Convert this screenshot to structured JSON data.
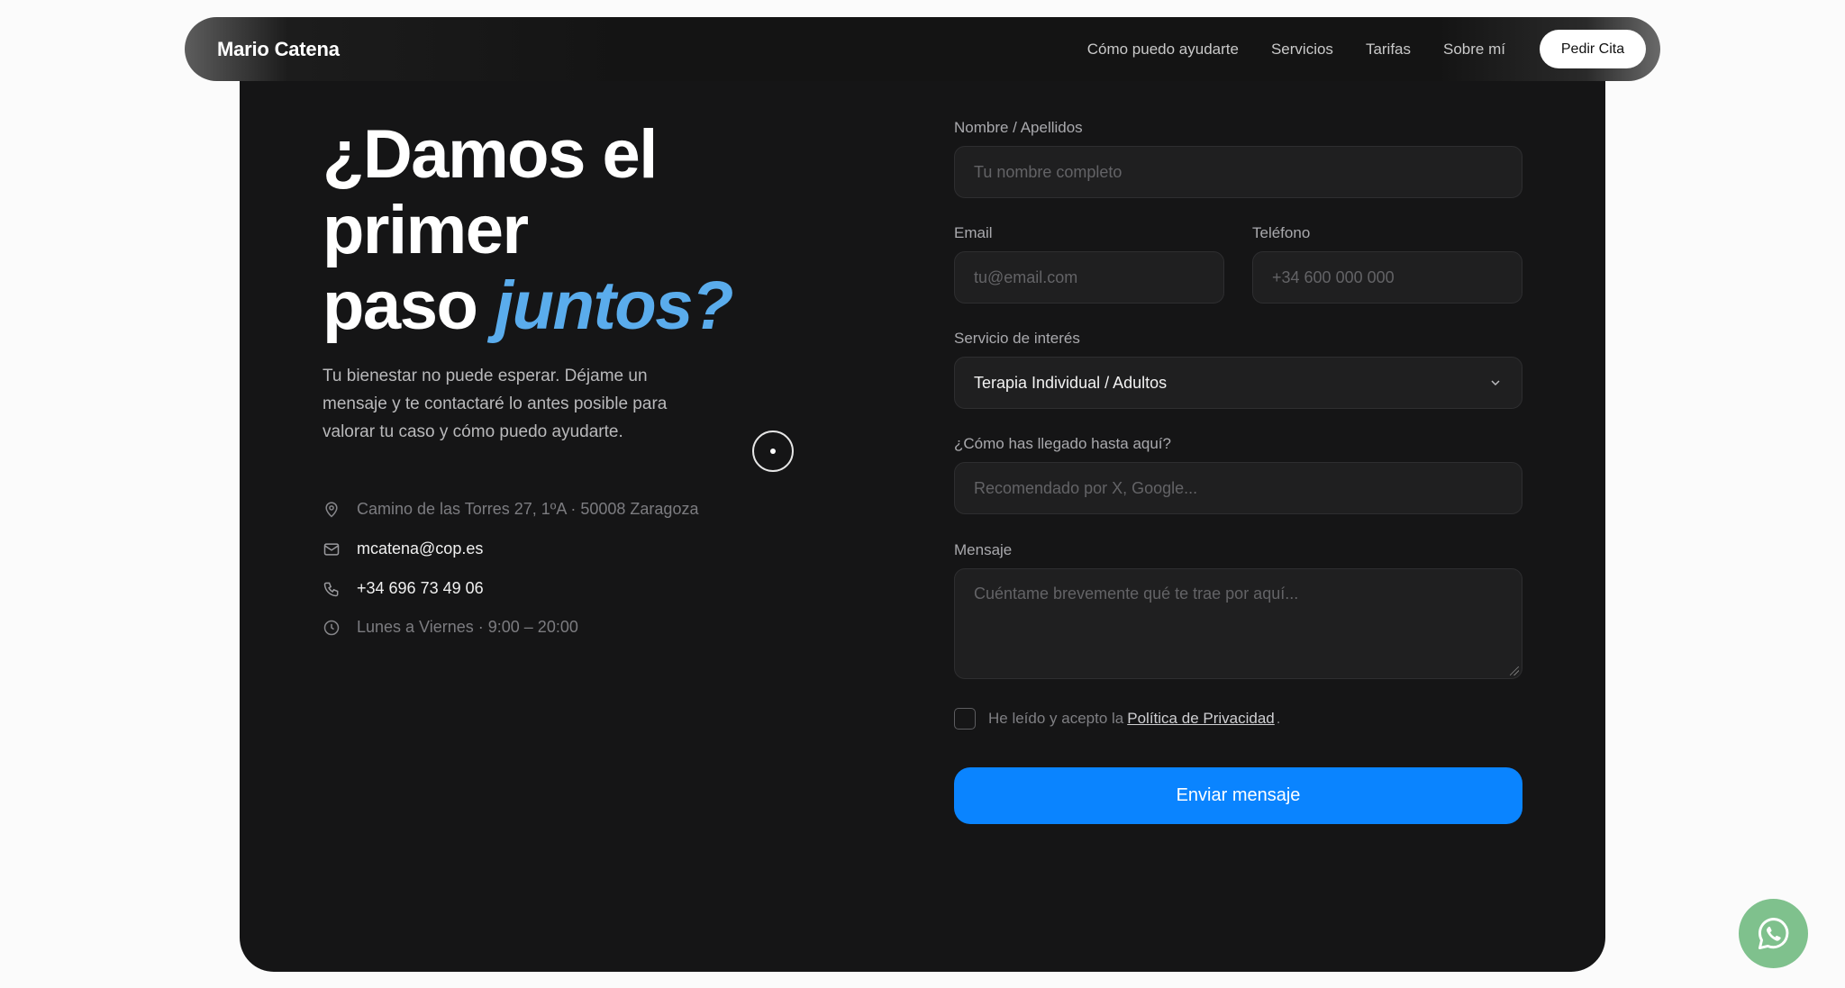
{
  "nav": {
    "brand": "Mario Catena",
    "links": [
      "Cómo puedo ayudarte",
      "Servicios",
      "Tarifas",
      "Sobre mí"
    ],
    "cta": "Pedir Cita"
  },
  "hero": {
    "line1": "¿Damos el",
    "line2": "primer",
    "line3_pre": "paso ",
    "line3_accent": "juntos?",
    "lead": "Tu bienestar no puede esperar. Déjame un mensaje y te contactaré lo antes posible para valorar tu caso y cómo puedo ayudarte."
  },
  "contact": {
    "address": "Camino de las Torres 27, 1ºA · 50008 Zaragoza",
    "email": "mcatena@cop.es",
    "phone": "+34 696 73 49 06",
    "hours": "Lunes a Viernes · 9:00 – 20:00",
    "icons": [
      "map-pin-icon",
      "mail-icon",
      "phone-icon",
      "clock-icon"
    ]
  },
  "form": {
    "name_label": "Nombre / Apellidos",
    "name_placeholder": "Tu nombre completo",
    "email_label": "Email",
    "email_placeholder": "tu@email.com",
    "phone_label": "Teléfono",
    "phone_placeholder": "+34 600 000 000",
    "service_label": "Servicio de interés",
    "service_value": "Terapia Individual / Adultos",
    "source_label": "¿Cómo has llegado hasta aquí?",
    "source_placeholder": "Recomendado por X, Google...",
    "message_label": "Mensaje",
    "message_placeholder": "Cuéntame brevemente qué te trae por aquí...",
    "consent_text": "He leído y acepto la",
    "consent_link": "Política de Privacidad",
    "consent_end": ".",
    "submit": "Enviar mensaje"
  },
  "colors": {
    "accent_blue": "#5aacec",
    "button_blue": "#0a84ff",
    "card_bg": "#151516",
    "whatsapp": "#7fc18d"
  }
}
